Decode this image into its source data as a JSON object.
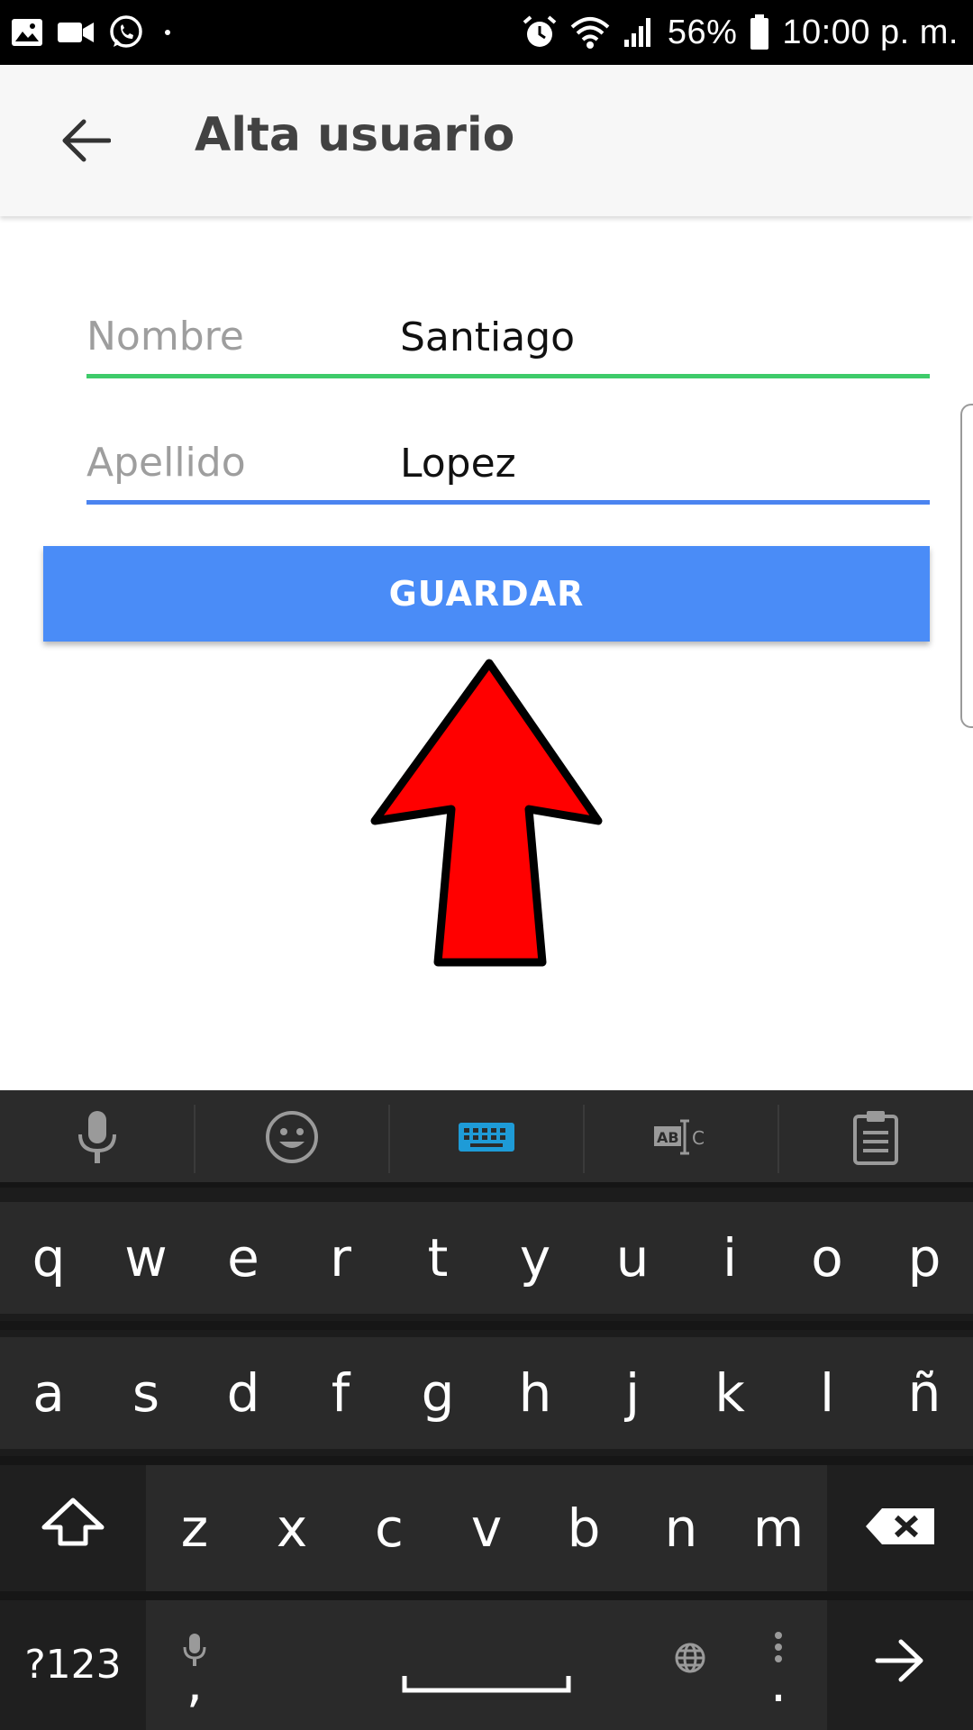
{
  "status_bar": {
    "battery": "56%",
    "time": "10:00 p. m.",
    "left_icons": [
      "gallery-icon",
      "video-icon",
      "whatsapp-icon",
      "dot-icon"
    ],
    "right_icons": [
      "alarm-icon",
      "wifi-icon",
      "signal-icon",
      "battery-icon"
    ]
  },
  "app_bar": {
    "title": "Alta usuario",
    "back_icon": "arrow-left-icon"
  },
  "form": {
    "fields": [
      {
        "label": "Nombre",
        "value": "Santiago",
        "underline_color": "#3ecb6a"
      },
      {
        "label": "Apellido",
        "value": "Lopez",
        "underline_color": "#4b84f0"
      }
    ],
    "save_label": "GUARDAR",
    "save_color": "#4a8cf7"
  },
  "annotation": {
    "arrow_icon": "red-up-arrow-icon",
    "arrow_color": "#ff0000"
  },
  "keyboard": {
    "toolbar": [
      "microphone-icon",
      "emoji-icon",
      "keyboard-icon",
      "text-select-icon",
      "clipboard-icon"
    ],
    "row1": [
      "q",
      "w",
      "e",
      "r",
      "t",
      "y",
      "u",
      "i",
      "o",
      "p"
    ],
    "row2": [
      "a",
      "s",
      "d",
      "f",
      "g",
      "h",
      "j",
      "k",
      "l",
      "ñ"
    ],
    "row3": [
      "z",
      "x",
      "c",
      "v",
      "b",
      "n",
      "m"
    ],
    "symbols_label": "?123",
    "comma": ",",
    "period": ".",
    "accent_color": "#1e9bd7"
  }
}
